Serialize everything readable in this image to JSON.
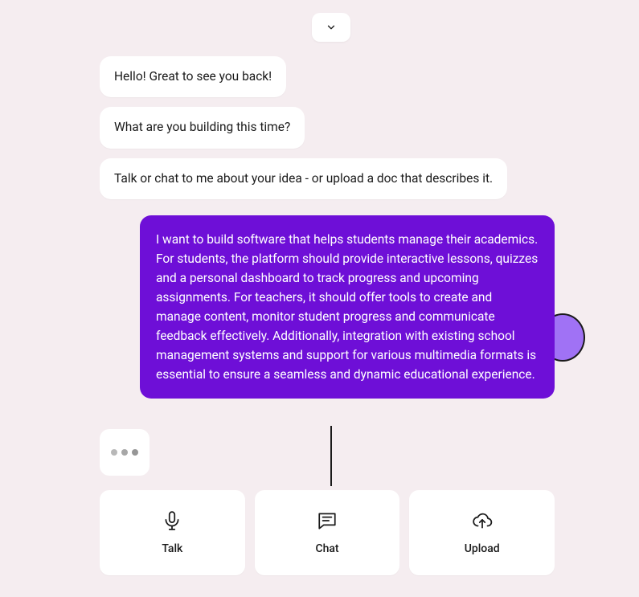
{
  "messages": {
    "assistant_1": "Hello! Great to see you back!",
    "assistant_2": "What are you building this time?",
    "assistant_3": "Talk or chat to me about your idea - or upload a doc that describes it.",
    "user_1": "I want to build software that helps students manage their academics. For students, the platform should provide interactive lessons, quizzes and a personal dashboard to track progress and upcoming assignments. For teachers, it should offer tools to create and manage content, monitor student progress and communicate feedback effectively. Additionally, integration with existing school management systems and support for various multimedia formats is essential to ensure a seamless and dynamic educational experience."
  },
  "actions": {
    "talk": "Talk",
    "chat": "Chat",
    "upload": "Upload"
  },
  "colors": {
    "user_bubble": "#6e0fd7",
    "background": "#f5edf0",
    "accent_blob": "#a072f5"
  }
}
